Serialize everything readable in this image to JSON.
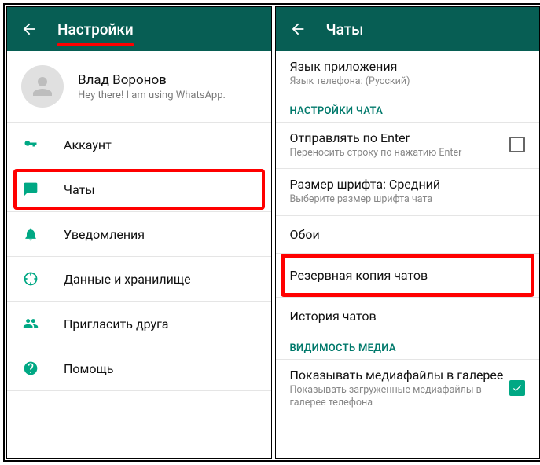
{
  "left": {
    "appbar_title": "Настройки",
    "profile": {
      "name": "Влад Воронов",
      "status": "Hey there! I am using WhatsApp."
    },
    "items": [
      {
        "icon": "key-icon",
        "label": "Аккаунт"
      },
      {
        "icon": "chat-icon",
        "label": "Чаты",
        "highlight": true
      },
      {
        "icon": "bell-icon",
        "label": "Уведомления"
      },
      {
        "icon": "data-icon",
        "label": "Данные и хранилище"
      },
      {
        "icon": "invite-icon",
        "label": "Пригласить друга"
      },
      {
        "icon": "help-icon",
        "label": "Помощь"
      }
    ]
  },
  "right": {
    "appbar_title": "Чаты",
    "rows": [
      {
        "title": "Язык приложения",
        "sub": "Язык телефона: (Русский)"
      }
    ],
    "section1": "НАСТРОЙКИ ЧАТА",
    "enter": {
      "title": "Отправлять по Enter",
      "sub": "Переносить строку по нажатию Enter"
    },
    "font": {
      "title": "Размер шрифта: Средний",
      "sub": "Выберите размер шрифта чата"
    },
    "wallpaper": {
      "title": "Обои"
    },
    "backup": {
      "title": "Резервная копия чатов"
    },
    "history": {
      "title": "История чатов"
    },
    "section2": "ВИДИМОСТЬ МЕДИА",
    "media": {
      "title": "Показывать медиафайлы в галерее",
      "sub": "Показывать загруженные медиафайлы в галерее телефона"
    }
  }
}
